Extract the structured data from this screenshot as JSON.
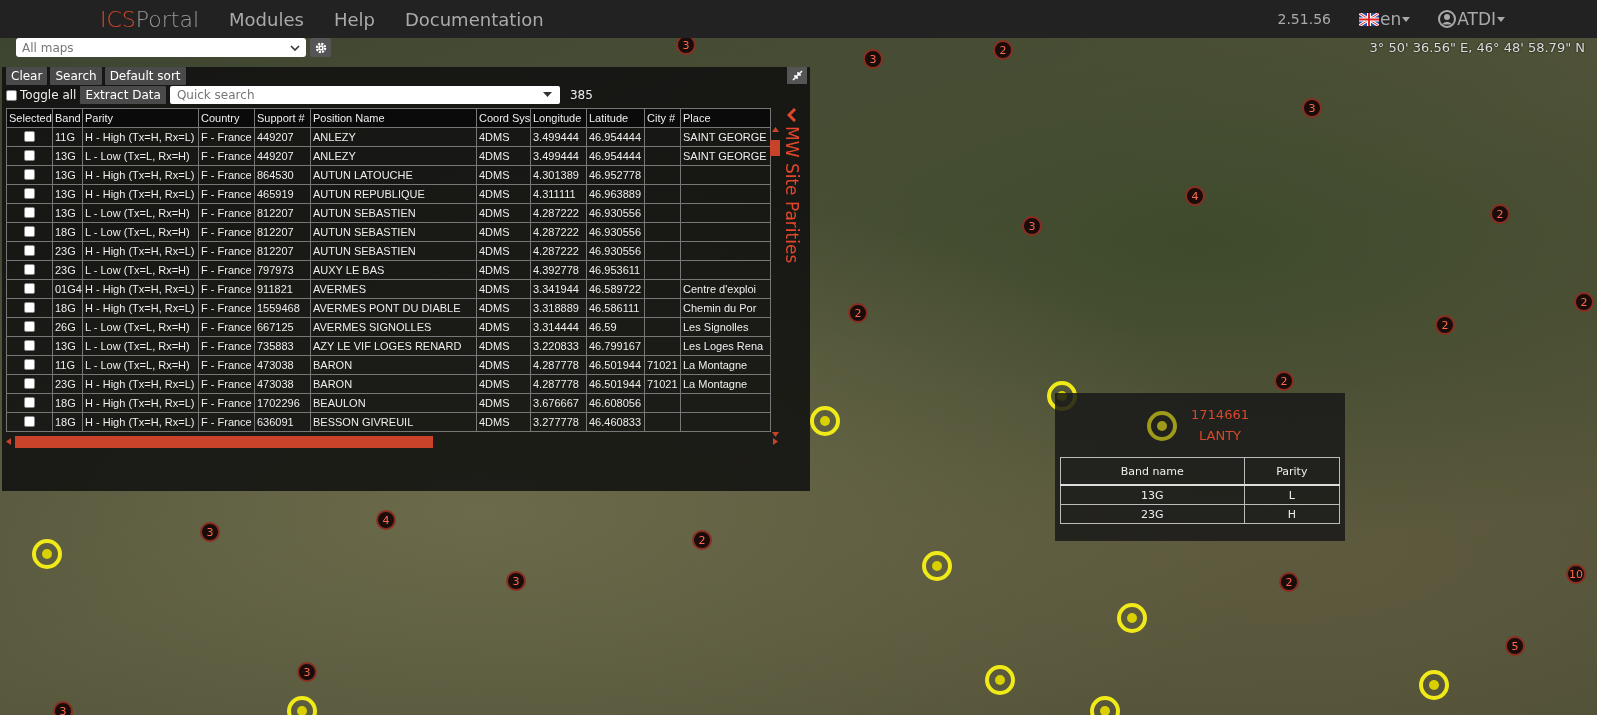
{
  "topbar": {
    "brand_prefix": "ICS",
    "brand_suffix": "Portal",
    "menu": [
      "Modules",
      "Help",
      "Documentation"
    ],
    "version": "2.51.56",
    "language": "en",
    "user": "ATDI"
  },
  "map_toolbar": {
    "map_select": "All maps",
    "coordinates": "3° 50' 36.56\" E, 46° 48' 58.79\" N"
  },
  "panel": {
    "buttons": [
      "Clear",
      "Search",
      "Default sort"
    ],
    "toggle_all": {
      "label": "Toggle all",
      "checked": false
    },
    "extract_button": "Extract Data",
    "quick_search": {
      "placeholder": "Quick search"
    },
    "count": "385",
    "side_tab": "MW Site Parities",
    "columns": [
      "Selected",
      "Band",
      "Parity",
      "Country",
      "Support #",
      "Position Name",
      "Coord Sys",
      "Longitude",
      "Latitude",
      "City #",
      "Place"
    ],
    "rows": [
      {
        "selected": false,
        "cells": [
          "",
          "11G",
          "H - High (Tx=H, Rx=L)",
          "F - France",
          "449207",
          "ANLEZY",
          "4DMS",
          "3.499444",
          "46.954444",
          "",
          "SAINT GEORGE"
        ]
      },
      {
        "selected": false,
        "cells": [
          "",
          "13G",
          "L - Low (Tx=L, Rx=H)",
          "F - France",
          "449207",
          "ANLEZY",
          "4DMS",
          "3.499444",
          "46.954444",
          "",
          "SAINT GEORGE"
        ]
      },
      {
        "selected": false,
        "cells": [
          "",
          "13G",
          "H - High (Tx=H, Rx=L)",
          "F - France",
          "864530",
          "AUTUN LATOUCHE",
          "4DMS",
          "4.301389",
          "46.952778",
          "",
          ""
        ]
      },
      {
        "selected": false,
        "cells": [
          "",
          "13G",
          "H - High (Tx=H, Rx=L)",
          "F - France",
          "465919",
          "AUTUN REPUBLIQUE",
          "4DMS",
          "4.311111",
          "46.963889",
          "",
          ""
        ]
      },
      {
        "selected": false,
        "cells": [
          "",
          "13G",
          "L - Low (Tx=L, Rx=H)",
          "F - France",
          "812207",
          "AUTUN SEBASTIEN",
          "4DMS",
          "4.287222",
          "46.930556",
          "",
          ""
        ]
      },
      {
        "selected": false,
        "cells": [
          "",
          "18G",
          "L - Low (Tx=L, Rx=H)",
          "F - France",
          "812207",
          "AUTUN SEBASTIEN",
          "4DMS",
          "4.287222",
          "46.930556",
          "",
          ""
        ]
      },
      {
        "selected": false,
        "cells": [
          "",
          "23G",
          "H - High (Tx=H, Rx=L)",
          "F - France",
          "812207",
          "AUTUN SEBASTIEN",
          "4DMS",
          "4.287222",
          "46.930556",
          "",
          ""
        ]
      },
      {
        "selected": false,
        "cells": [
          "",
          "23G",
          "L - Low (Tx=L, Rx=H)",
          "F - France",
          "797973",
          "AUXY LE BAS",
          "4DMS",
          "4.392778",
          "46.953611",
          "",
          ""
        ]
      },
      {
        "selected": false,
        "cells": [
          "",
          "01G4",
          "H - High (Tx=H, Rx=L)",
          "F - France",
          "911821",
          "AVERMES",
          "4DMS",
          "3.341944",
          "46.589722",
          "",
          "Centre d'exploi"
        ]
      },
      {
        "selected": false,
        "cells": [
          "",
          "18G",
          "H - High (Tx=H, Rx=L)",
          "F - France",
          "1559468",
          "AVERMES PONT DU DIABLE",
          "4DMS",
          "3.318889",
          "46.586111",
          "",
          "Chemin du Por"
        ]
      },
      {
        "selected": false,
        "cells": [
          "",
          "26G",
          "L - Low (Tx=L, Rx=H)",
          "F - France",
          "667125",
          "AVERMES SIGNOLLES",
          "4DMS",
          "3.314444",
          "46.59",
          "",
          "Les Signolles"
        ]
      },
      {
        "selected": false,
        "cells": [
          "",
          "13G",
          "L - Low (Tx=L, Rx=H)",
          "F - France",
          "735883",
          "AZY LE VIF LOGES RENARD",
          "4DMS",
          "3.220833",
          "46.799167",
          "",
          "Les Loges Rena"
        ]
      },
      {
        "selected": false,
        "cells": [
          "",
          "11G",
          "L - Low (Tx=L, Rx=H)",
          "F - France",
          "473038",
          "BARON",
          "4DMS",
          "4.287778",
          "46.501944",
          "71021",
          "La Montagne"
        ]
      },
      {
        "selected": false,
        "cells": [
          "",
          "23G",
          "H - High (Tx=H, Rx=L)",
          "F - France",
          "473038",
          "BARON",
          "4DMS",
          "4.287778",
          "46.501944",
          "71021",
          "La Montagne"
        ]
      },
      {
        "selected": false,
        "cells": [
          "",
          "18G",
          "H - High (Tx=H, Rx=L)",
          "F - France",
          "1702296",
          "BEAULON",
          "4DMS",
          "3.676667",
          "46.608056",
          "",
          ""
        ]
      },
      {
        "selected": false,
        "cells": [
          "",
          "18G",
          "H - High (Tx=H, Rx=L)",
          "F - France",
          "636091",
          "BESSON GIVREUIL",
          "4DMS",
          "3.277778",
          "46.460833",
          "",
          ""
        ]
      }
    ]
  },
  "popup": {
    "support": "1714661",
    "name": "LANTY",
    "columns": [
      "Band name",
      "Parity"
    ],
    "rows": [
      [
        "13G",
        "L"
      ],
      [
        "23G",
        "H"
      ]
    ]
  },
  "map": {
    "clusters": [
      "3",
      "2",
      "3",
      "3",
      "4",
      "3",
      "2",
      "2",
      "2",
      "2",
      "2",
      "3",
      "4",
      "2",
      "3",
      "2",
      "10",
      "5",
      "3",
      "3"
    ]
  }
}
